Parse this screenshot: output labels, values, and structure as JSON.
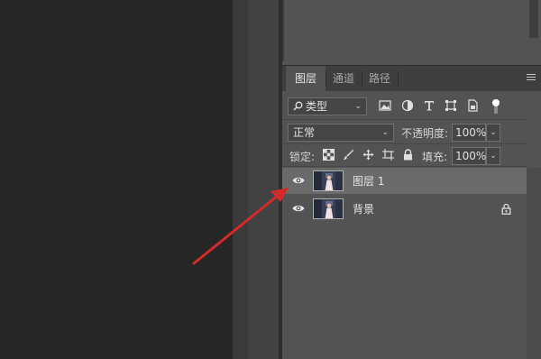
{
  "layers_panel": {
    "tabs": [
      "图层",
      "通道",
      "路径"
    ],
    "filter": {
      "icon": "search-icon",
      "kind_label": "类型"
    },
    "blend_mode": "正常",
    "opacity": {
      "label": "不透明度:",
      "value": "100%"
    },
    "lock": {
      "label": "锁定:"
    },
    "fill": {
      "label": "填充:",
      "value": "100%"
    },
    "layers": [
      {
        "name": "图层 1",
        "visible": true,
        "selected": true,
        "locked": false
      },
      {
        "name": "背景",
        "visible": true,
        "selected": false,
        "locked": true
      }
    ]
  },
  "annotation": {
    "type": "red-arrow",
    "color": "#d32a2a",
    "points_to": "layer-visibility-toggle"
  },
  "colors": {
    "canvas_bg": "#262626",
    "panel_bg": "#535353",
    "selected_row": "#6a6a6a"
  }
}
